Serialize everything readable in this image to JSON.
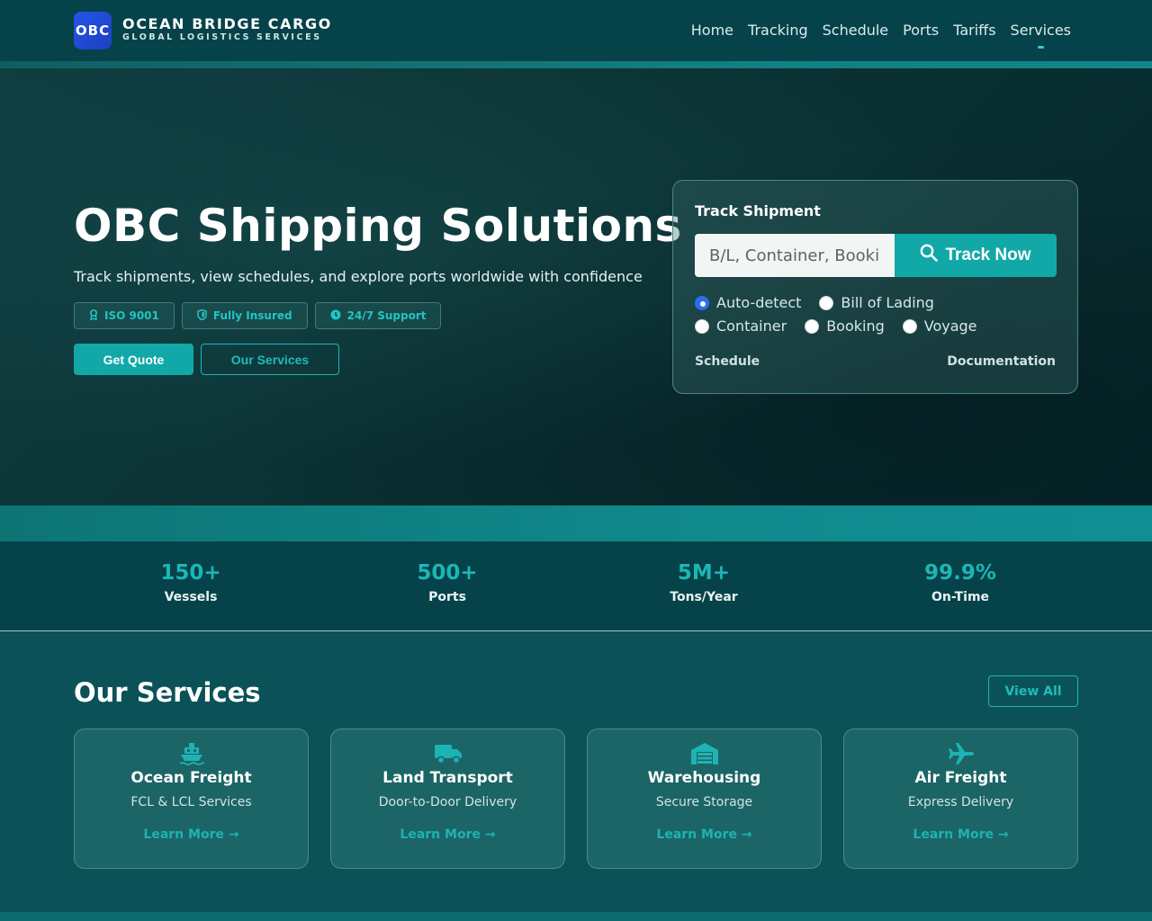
{
  "brand": {
    "badge": "OBC",
    "name": "OCEAN BRIDGE CARGO",
    "tagline": "GLOBAL LOGISTICS SERVICES"
  },
  "nav": [
    "Home",
    "Tracking",
    "Schedule",
    "Ports",
    "Tariffs",
    "Services"
  ],
  "hero": {
    "title": "OBC Shipping Solutions",
    "subtitle": "Track shipments, view schedules, and explore ports worldwide with confidence",
    "badges": [
      "ISO 9001",
      "Fully Insured",
      "24/7 Support"
    ],
    "primary_button": "Get Quote",
    "secondary_button": "Our Services"
  },
  "tracking": {
    "title": "Track Shipment",
    "input_placeholder": "B/L, Container, Booking",
    "button": "Track Now",
    "options": [
      "Auto-detect",
      "Bill of Lading",
      "Container",
      "Booking",
      "Voyage"
    ],
    "selected": "Auto-detect",
    "link_left": "Schedule",
    "link_right": "Documentation"
  },
  "stats": [
    {
      "value": "150+",
      "label": "Vessels"
    },
    {
      "value": "500+",
      "label": "Ports"
    },
    {
      "value": "5M+",
      "label": "Tons/Year"
    },
    {
      "value": "99.9%",
      "label": "On-Time"
    }
  ],
  "services": {
    "title": "Our Services",
    "view_all": "View All",
    "items": [
      {
        "name": "Ocean Freight",
        "desc": "FCL & LCL Services",
        "link": "Learn More →",
        "icon": "ship-icon"
      },
      {
        "name": "Land Transport",
        "desc": "Door-to-Door Delivery",
        "link": "Learn More →",
        "icon": "truck-icon"
      },
      {
        "name": "Warehousing",
        "desc": "Secure Storage",
        "link": "Learn More →",
        "icon": "warehouse-icon"
      },
      {
        "name": "Air Freight",
        "desc": "Express Delivery",
        "link": "Learn More →",
        "icon": "plane-icon"
      }
    ]
  },
  "colors": {
    "accent": "#12a8a8",
    "header": "#064249",
    "radio_selected": "#2a6ef0"
  }
}
